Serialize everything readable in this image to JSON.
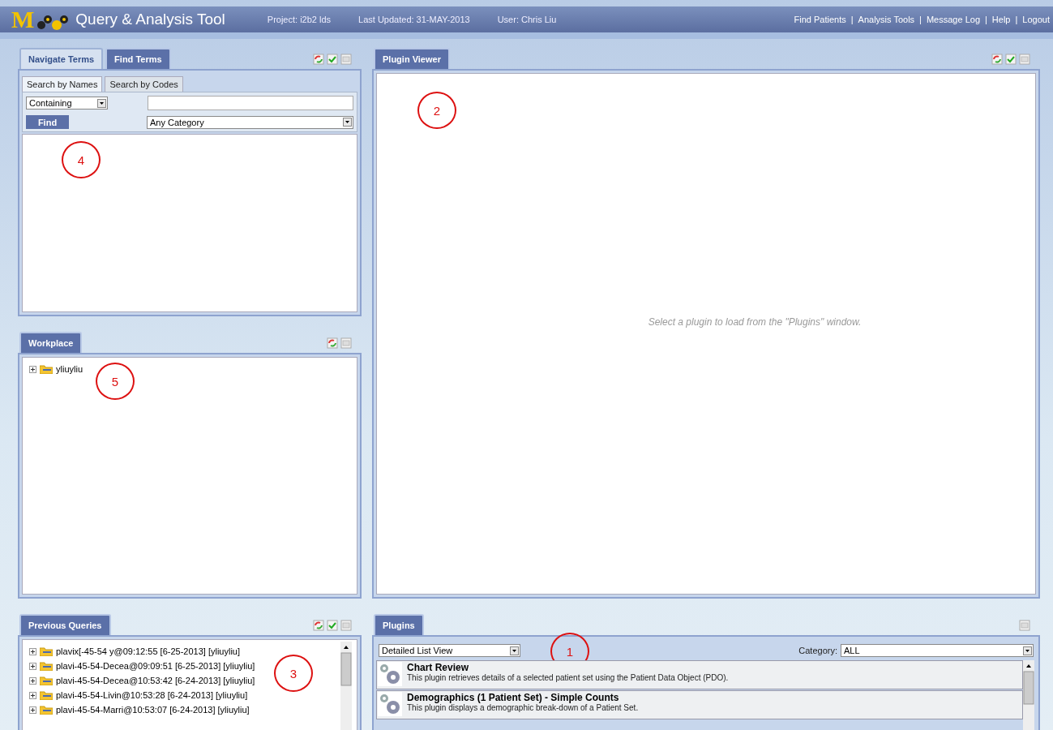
{
  "header": {
    "logo_letter": "M",
    "title": "Query & Analysis Tool",
    "project": "Project: i2b2 lds",
    "last_updated": "Last Updated: 31-MAY-2013",
    "user": "User: Chris Liu",
    "nav": [
      {
        "label": "Find Patients",
        "separator": "|"
      },
      {
        "label": "Analysis Tools",
        "separator": "|"
      },
      {
        "label": "Message Log",
        "separator": "|"
      },
      {
        "label": "Help",
        "separator": "|"
      },
      {
        "label": "Logout"
      }
    ]
  },
  "terms_panel": {
    "annotation": "4",
    "tabs": [
      {
        "label": "Navigate Terms",
        "selected": false
      },
      {
        "label": "Find Terms",
        "selected": true
      }
    ],
    "subtabs": [
      {
        "label": "Search by Names",
        "selected": true
      },
      {
        "label": "Search by Codes",
        "selected": false
      }
    ],
    "match_select": "Containing",
    "find_button": "Find",
    "category_select": "Any Category"
  },
  "workplace_panel": {
    "annotation": "5",
    "tab": "Workplace",
    "items": [
      {
        "label": "yliuyliu",
        "expanded": false
      }
    ]
  },
  "queries_panel": {
    "annotation": "3",
    "tab": "Previous Queries",
    "items": [
      {
        "label": "plavix[-45-54 y@09:12:55 [6-25-2013] [yliuyliu]"
      },
      {
        "label": "plavi-45-54-Decea@09:09:51 [6-25-2013] [yliuyliu]"
      },
      {
        "label": "plavi-45-54-Decea@10:53:42 [6-24-2013] [yliuyliu]"
      },
      {
        "label": "plavi-45-54-Livin@10:53:28 [6-24-2013] [yliuyliu]"
      },
      {
        "label": "plavi-45-54-Marri@10:53:07 [6-24-2013] [yliuyliu]"
      }
    ]
  },
  "viewer_panel": {
    "annotation": "2",
    "tab": "Plugin Viewer",
    "message": "Select a plugin to load from the \"Plugins\" window."
  },
  "plugins_panel": {
    "annotation": "1",
    "tab": "Plugins",
    "view_select": "Detailed List View",
    "category_label": "Category:",
    "category_select": "ALL",
    "items": [
      {
        "title": "Chart Review",
        "description": "This plugin retrieves details of a selected patient set using the Patient Data Object (PDO)."
      },
      {
        "title": "Demographics (1 Patient Set) - Simple Counts",
        "description": "This plugin displays a demographic break-down of a Patient Set."
      }
    ]
  }
}
